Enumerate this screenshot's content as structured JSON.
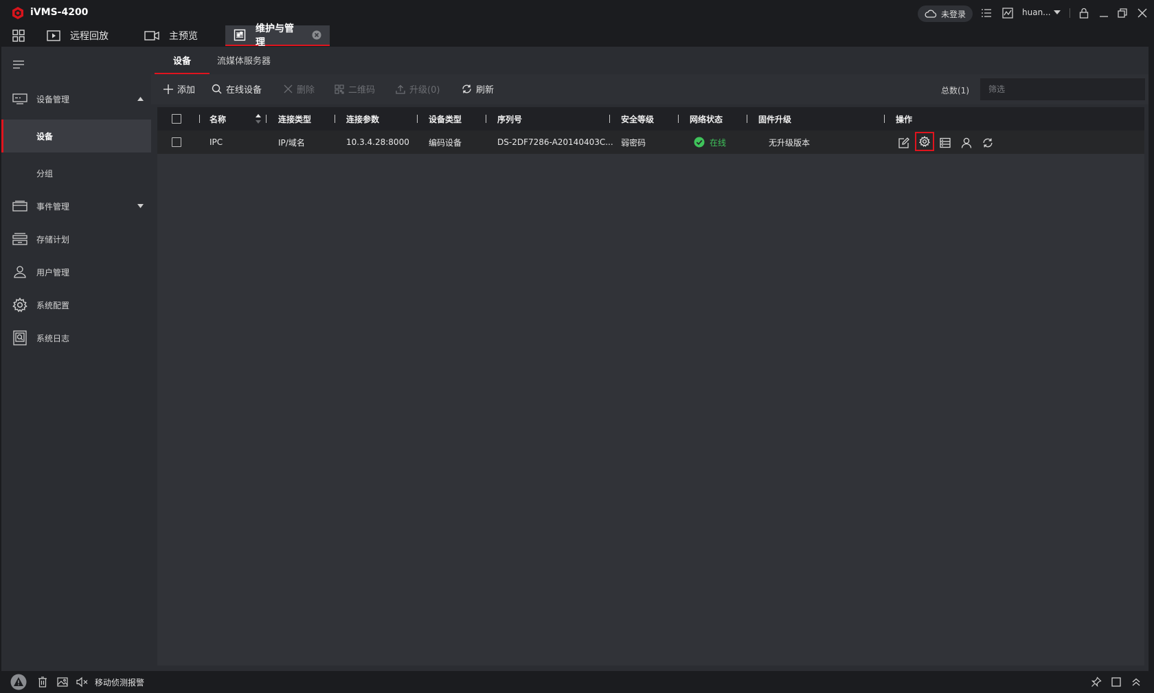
{
  "app": {
    "title": "iVMS-4200"
  },
  "tabs": [
    {
      "label": "远程回放"
    },
    {
      "label": "主预览"
    },
    {
      "label": "维护与管理"
    }
  ],
  "header": {
    "login_status": "未登录",
    "user": "huan..."
  },
  "sidebar": {
    "items": [
      {
        "label": "设备管理"
      },
      {
        "label": "设备"
      },
      {
        "label": "分组"
      },
      {
        "label": "事件管理"
      },
      {
        "label": "存储计划"
      },
      {
        "label": "用户管理"
      },
      {
        "label": "系统配置"
      },
      {
        "label": "系统日志"
      }
    ]
  },
  "subtabs": [
    {
      "label": "设备"
    },
    {
      "label": "流媒体服务器"
    }
  ],
  "toolbar": {
    "add": "添加",
    "online": "在线设备",
    "delete": "删除",
    "qr": "二维码",
    "upgrade": "升级(0)",
    "refresh": "刷新",
    "total": "总数(1)",
    "filter_placeholder": "筛选"
  },
  "table": {
    "columns": [
      "名称",
      "连接类型",
      "连接参数",
      "设备类型",
      "序列号",
      "安全等级",
      "网络状态",
      "固件升级",
      "操作"
    ],
    "rows": [
      {
        "name": "IPC",
        "conn_type": "IP/域名",
        "conn_param": "10.3.4.28:8000",
        "device_type": "编码设备",
        "serial": "DS-2DF7286-A20140403C...",
        "security": "弱密码",
        "network": "在线",
        "firmware": "无升级版本"
      }
    ]
  },
  "statusbar": {
    "alarm": "移动侦测报警"
  },
  "colors": {
    "accent": "#e0141e",
    "online": "#3fc35a",
    "background": "#2b2d32"
  }
}
